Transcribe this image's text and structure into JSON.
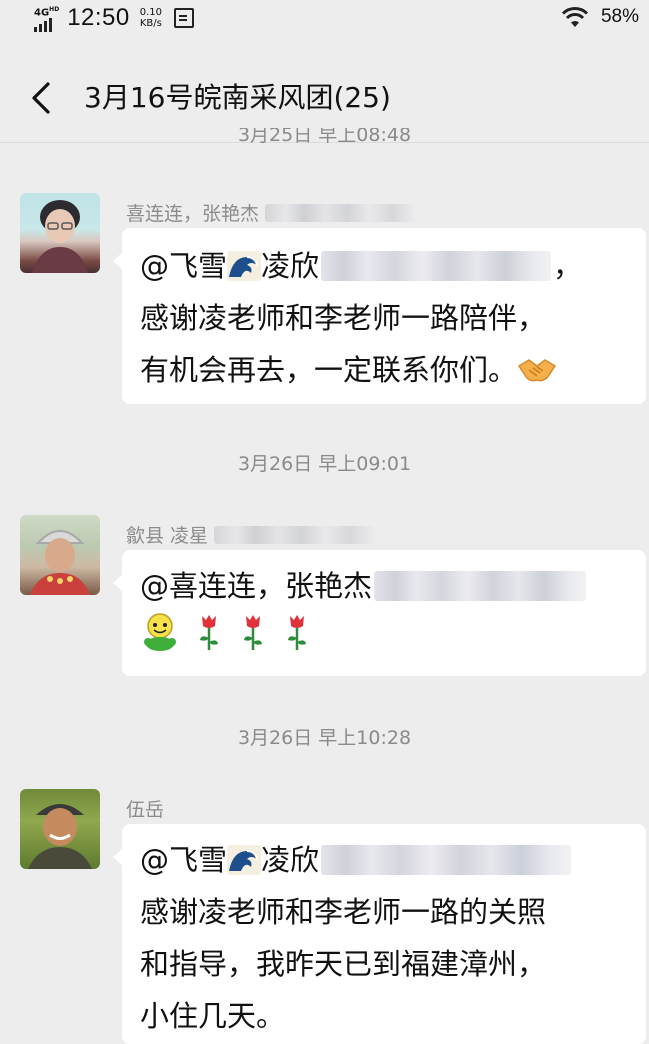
{
  "status_bar": {
    "network": "4G",
    "network_sup": "HD",
    "time": "12:50",
    "speed_value": "0.10",
    "speed_unit": "KB/s",
    "battery": "58%",
    "icons": [
      "signal-icon",
      "notification-icon",
      "wifi-icon"
    ]
  },
  "header": {
    "back_icon": "chevron-left-icon",
    "title": "3月16号皖南采风团(25)"
  },
  "timestamps": {
    "cut_top": "3月25日 早上08:48",
    "second": "3月26日 早上09:01",
    "third": "3月26日 早上10:28"
  },
  "messages": [
    {
      "sender": "喜连连，张艳杰",
      "lines": [
        {
          "prefix": "@飞雪",
          "emoji": "wave-emoji",
          "suffix": "凌欣",
          "tail": "，"
        },
        {
          "text": "感谢凌老师和李老师一路陪伴，"
        },
        {
          "text": "有机会再去，一定联系你们。",
          "emoji": "handshake-emoji"
        }
      ]
    },
    {
      "sender": "歙县 凌星",
      "lines": [
        {
          "text": "@喜连连，张艳杰"
        },
        {
          "emojis": [
            "smiley-emoji",
            "rose-emoji",
            "rose-emoji",
            "rose-emoji"
          ]
        }
      ]
    },
    {
      "sender": "伍岳",
      "lines": [
        {
          "prefix": "@飞雪",
          "emoji": "wave-emoji",
          "suffix": "凌欣"
        },
        {
          "text": "感谢凌老师和李老师一路的关照"
        },
        {
          "text": "和指导，我昨天已到福建漳州，"
        },
        {
          "text": "小住几天。"
        }
      ]
    }
  ],
  "colors": {
    "background": "#ededed",
    "bubble": "#ffffff",
    "timestamp_text": "#8a8a8a",
    "sender_text": "#8c8c8c"
  }
}
